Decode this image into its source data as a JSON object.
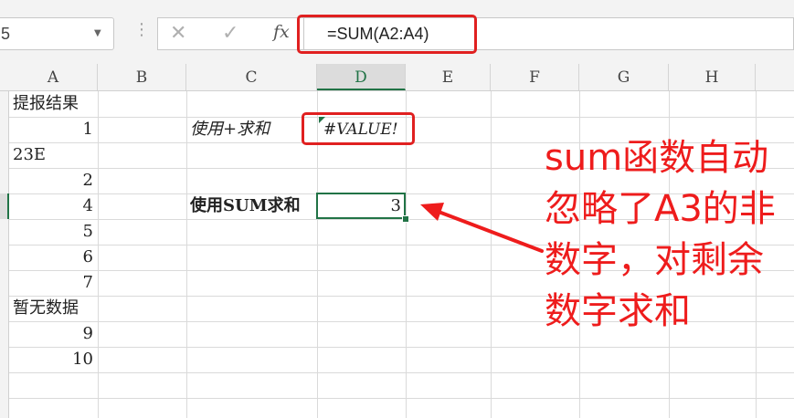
{
  "toolbar": {
    "name_box": "5",
    "cancel_icon": "✕",
    "enter_icon": "✓",
    "fx_label": "fx",
    "formula": "=SUM(A2:A4)"
  },
  "columns": [
    "A",
    "B",
    "C",
    "D",
    "E",
    "F",
    "G",
    "H"
  ],
  "cells": {
    "A1": "提报结果",
    "A2": "1",
    "A3": "23E",
    "A4": "2",
    "A5": "4",
    "A6": "5",
    "A7": "6",
    "A8": "7",
    "A9": "暂无数据",
    "A10": "9",
    "A11": "10",
    "C2": "使用+求和",
    "D2": "#VALUE!",
    "C5": "使用SUM求和",
    "D5": "3"
  },
  "annotation": "sum函数自动忽略了A3的非数字，对剩余数字求和",
  "colors": {
    "accent_green": "#217346",
    "highlight_red": "#e02020",
    "annotation_red": "#ee1c1c"
  }
}
